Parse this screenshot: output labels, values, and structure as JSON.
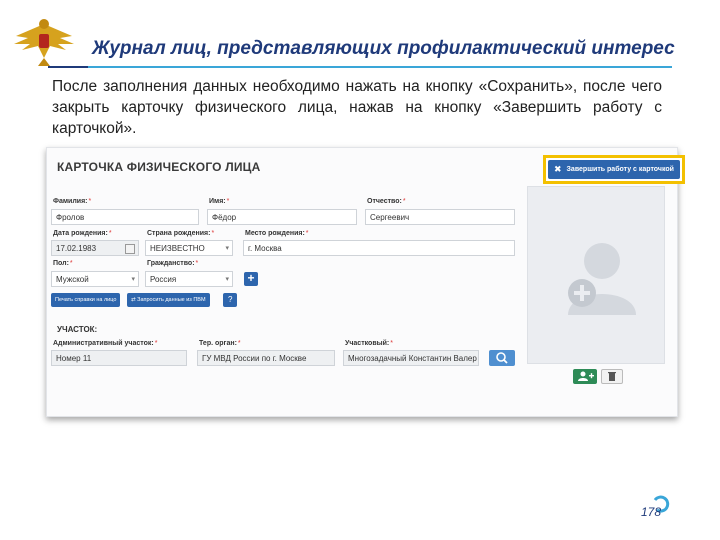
{
  "slide": {
    "title": "Журнал лиц, представляющих профилактический интерес",
    "intro": "После заполнения данных необходимо нажать на кнопку «Сохранить», после чего закрыть карточку физического лица, нажав на кнопку «Завершить работу с карточкой».",
    "page_number": "178"
  },
  "card": {
    "title": "КАРТОЧКА ФИЗИЧЕСКОГО ЛИЦА",
    "finish_button": "Завершить работу с карточкой",
    "fields": {
      "surname": {
        "label": "Фамилия:",
        "value": "Фролов"
      },
      "name": {
        "label": "Имя:",
        "value": "Фёдор"
      },
      "patronymic": {
        "label": "Отчество:",
        "value": "Сергеевич"
      },
      "birth_date": {
        "label": "Дата рождения:",
        "value": "17.02.1983"
      },
      "birth_country": {
        "label": "Страна рождения:",
        "value": "НЕИЗВЕСТНО"
      },
      "birth_place": {
        "label": "Место рождения:",
        "value": "г. Москва"
      },
      "sex": {
        "label": "Пол:",
        "value": "Мужской"
      },
      "citizenship": {
        "label": "Гражданство:",
        "value": "Россия"
      }
    },
    "buttons": {
      "print_certificate": "Печать справки на лицо",
      "request_pvm": "Запросить данные из ПВМ",
      "help": "?",
      "add": "+"
    },
    "district": {
      "title": "УЧАСТОК:",
      "admin_label": "Административный участок:",
      "admin_value": "Номер 11",
      "organ_label": "Тер. орган:",
      "organ_value": "ГУ МВД России по г. Москве",
      "officer_label": "Участковый:",
      "officer_value": "Многозадачный Константин Валер"
    }
  },
  "colors": {
    "accent": "#2d65ad",
    "highlight": "#f3c000",
    "title": "#1f3a7a",
    "line": "#3aa6d8",
    "add_photo": "#2e8b57"
  },
  "icons": [
    "emblem-icon",
    "close-icon",
    "calendar-icon",
    "search-icon",
    "avatar-placeholder-icon",
    "add-photo-icon",
    "trash-icon",
    "refresh-icon"
  ]
}
